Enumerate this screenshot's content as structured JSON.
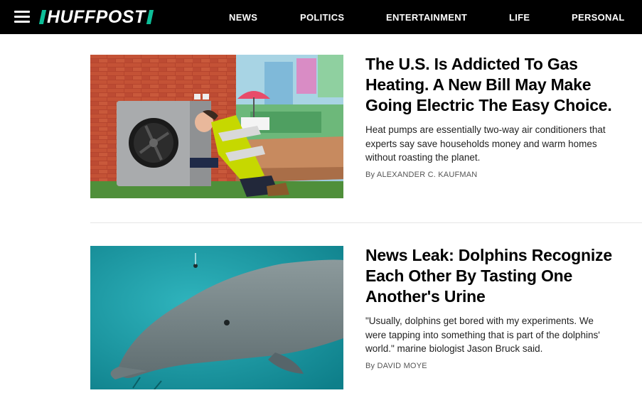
{
  "header": {
    "logo_text": "HUFFPOST",
    "nav": [
      "NEWS",
      "POLITICS",
      "ENTERTAINMENT",
      "LIFE",
      "PERSONAL"
    ]
  },
  "articles": [
    {
      "headline": "The U.S. Is Addicted To Gas Heating. A New Bill May Make Going Electric The Easy Choice.",
      "dek": "Heat pumps are essentially two-way air conditioners that experts say save households money and warm homes without roasting the planet.",
      "byline_prefix": "By",
      "author": "ALEXANDER C. KAUFMAN"
    },
    {
      "headline": "News Leak: Dolphins Recognize Each Other By Tasting One Another's Urine",
      "dek": "\"Usually, dolphins get bored with my experiments. We were tapping into something that is part of the dolphins' world.\" marine biologist Jason Bruck said.",
      "byline_prefix": "By",
      "author": "DAVID MOYE"
    }
  ],
  "colors": {
    "topbar": "#000000",
    "logo_accent": "#0dbe98"
  }
}
